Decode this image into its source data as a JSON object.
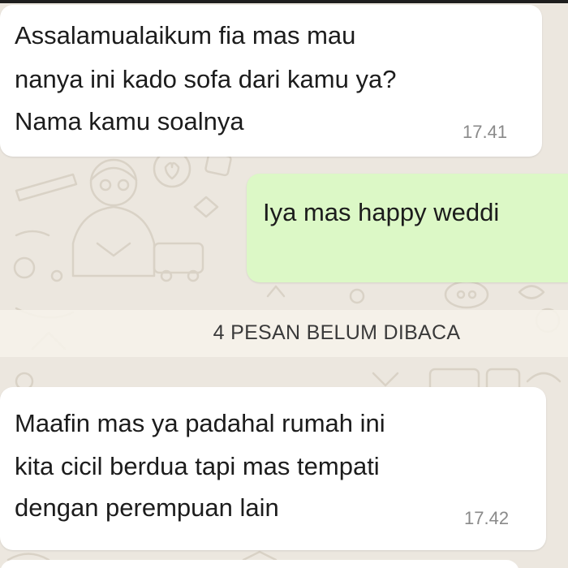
{
  "chat": {
    "messages": [
      {
        "direction": "incoming",
        "lines": [
          "Assalamualaikum fia mas mau",
          "nanya ini kado sofa dari kamu ya?",
          "Nama kamu soalnya"
        ],
        "time": "17.41"
      },
      {
        "direction": "outgoing",
        "lines": [
          "Iya mas happy weddi"
        ],
        "time": ""
      },
      {
        "direction": "incoming",
        "lines": [
          "Maafin mas ya padahal rumah ini",
          "kita cicil berdua tapi mas tempati",
          "dengan perempuan lain"
        ],
        "time": "17.42"
      }
    ],
    "unread_divider": "4 PESAN BELUM DIBACA"
  },
  "colors": {
    "wallpaper": "#ece7df",
    "incoming_bubble": "#ffffff",
    "outgoing_bubble": "#dcf8c6",
    "text": "#1c1c1c",
    "timestamp": "#8a8a8a"
  }
}
